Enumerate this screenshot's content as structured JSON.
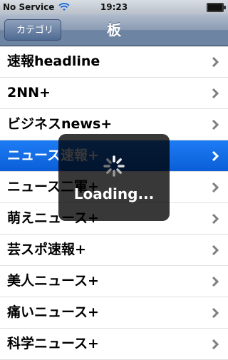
{
  "status": {
    "carrier": "No Service",
    "time": "19:23"
  },
  "nav": {
    "back_label": "カテゴリ",
    "title": "板"
  },
  "list": {
    "items": [
      "速報headline",
      "2NN+",
      "ビジネスnews+",
      "ニュース速報+",
      "ニュース二軍+",
      "萌えニュース+",
      "芸スポ速報+",
      "美人ニュース+",
      "痛いニュース+",
      "科学ニュース+"
    ],
    "selected_index": 3
  },
  "overlay": {
    "text": "Loading..."
  },
  "colors": {
    "selection": "#0b5fd8",
    "nav": "#6d84a2"
  }
}
